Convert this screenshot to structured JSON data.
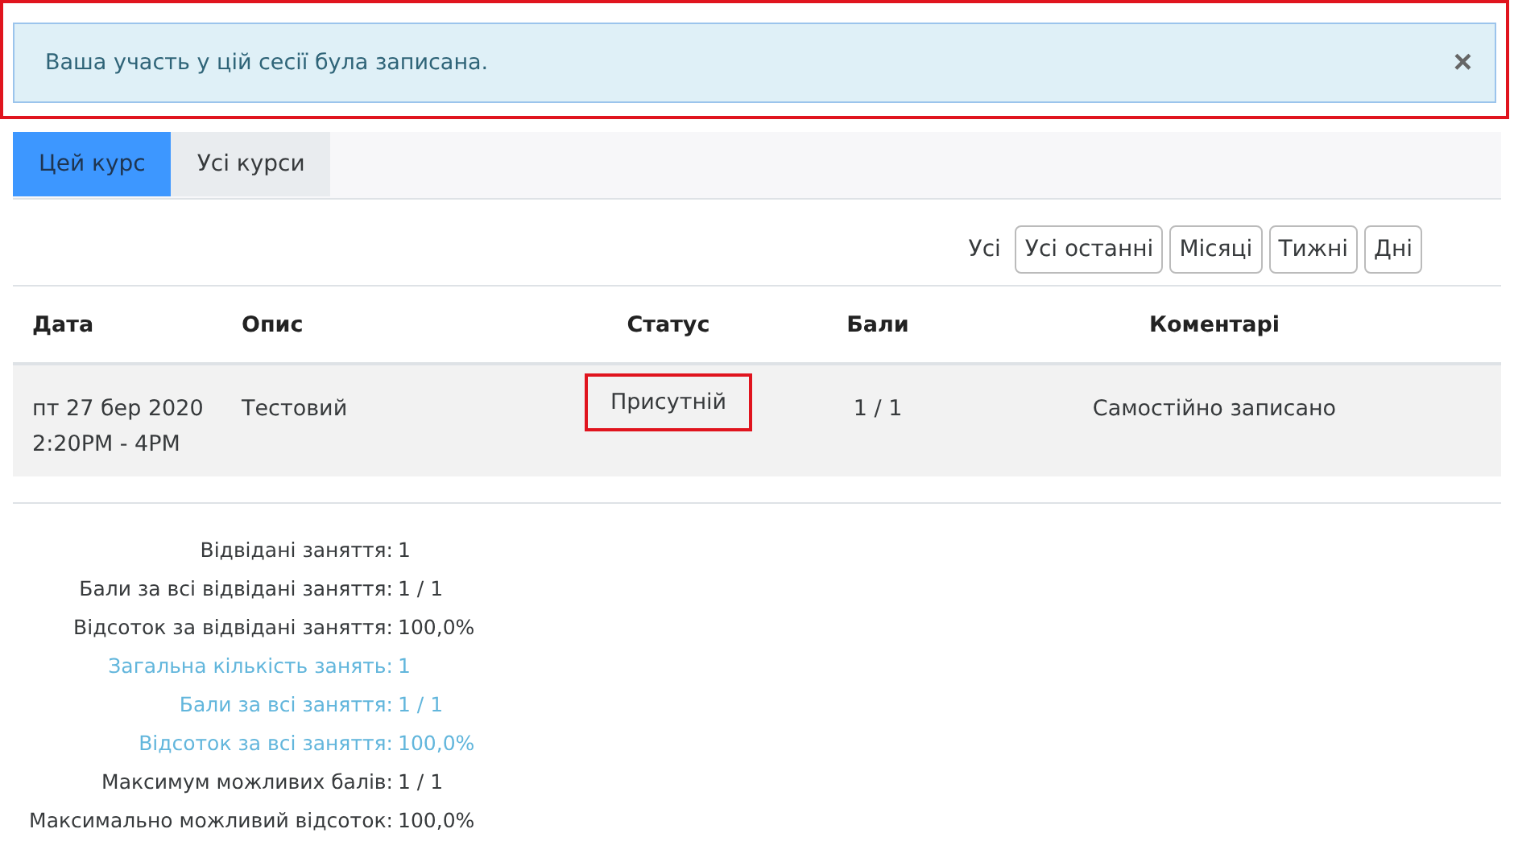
{
  "alert": {
    "message": "Ваша участь у цій сесії була записана.",
    "close": "×",
    "highlighted": true
  },
  "tabs": [
    {
      "label": "Цей курс",
      "selected": true
    },
    {
      "label": "Усі курси",
      "selected": false
    }
  ],
  "filters": {
    "label": "Усі",
    "buttons": [
      "Усі останні",
      "Місяці",
      "Тижні",
      "Дні"
    ]
  },
  "table": {
    "columns": [
      "Дата",
      "Опис",
      "Статус",
      "Бали",
      "Коментарі"
    ],
    "rows": [
      {
        "date": "пт 27 бер 2020",
        "time": "2:20PM - 4PM",
        "description": "Тестовий",
        "status": "Присутній",
        "status_highlighted": true,
        "points": "1 / 1",
        "comment": "Самостійно записано"
      }
    ]
  },
  "summary": [
    {
      "label": "Відвідані заняття:",
      "value": "1",
      "kind": "attended"
    },
    {
      "label": "Бали за всі відвідані заняття:",
      "value": "1 / 1",
      "kind": "attended"
    },
    {
      "label": "Відсоток за відвідані заняття:",
      "value": "100,0%",
      "kind": "attended"
    },
    {
      "label": "Загальна кількість занять:",
      "value": "1",
      "kind": "overall"
    },
    {
      "label": "Бали за всі заняття:",
      "value": "1 / 1",
      "kind": "overall"
    },
    {
      "label": "Відсоток за всі заняття:",
      "value": "100,0%",
      "kind": "overall"
    },
    {
      "label": "Максимум можливих балів:",
      "value": "1 / 1",
      "kind": "maximum"
    },
    {
      "label": "Максимально можливий відсоток:",
      "value": "100,0%",
      "kind": "maximum"
    }
  ]
}
